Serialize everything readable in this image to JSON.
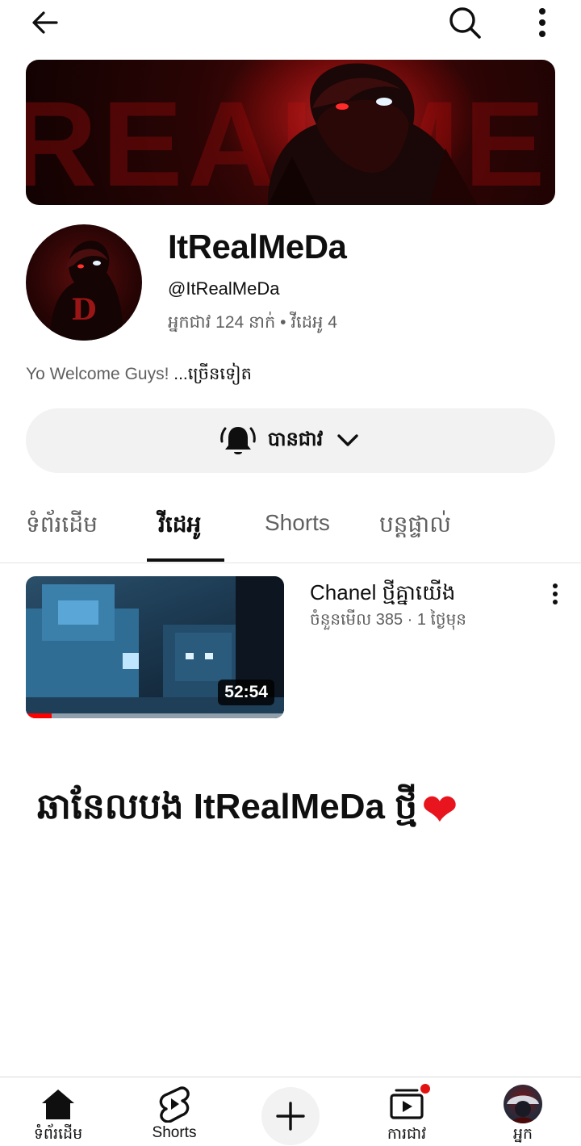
{
  "topbar": {
    "back_icon": "arrow-left-icon",
    "search_icon": "search-icon",
    "more_icon": "more-vertical-icon"
  },
  "banner": {
    "text": "REALME"
  },
  "channel": {
    "name": "ItRealMeDa",
    "handle": "@ItRealMeDa",
    "stats": "អ្នកជាវ 124 នាក់ • វីដេអូ 4",
    "description": "Yo Welcome Guys! ",
    "description_more": "...ច្រើនទៀត"
  },
  "subscribe": {
    "label": "បានជាវ",
    "bell_icon": "bell-icon",
    "chevron_icon": "chevron-down-icon"
  },
  "tabs": [
    {
      "label": "ទំព័រដើម",
      "active": false
    },
    {
      "label": "វីដេអូ",
      "active": true
    },
    {
      "label": "Shorts",
      "active": false
    },
    {
      "label": "បន្តផ្ទាល់",
      "active": false
    }
  ],
  "videos": [
    {
      "title": "Chanel ថ្មីគ្នាយើង",
      "meta": "ចំនួនមើល 385 · 1 ថ្ងៃមុន",
      "duration": "52:54",
      "watched_fraction": 0.1
    }
  ],
  "caption": {
    "text": "ឆានែលបង ItRealMeDa ថ្មី",
    "emoji": "❤"
  },
  "bottom_nav": [
    {
      "label": "ទំព័រដើម",
      "icon": "home-icon"
    },
    {
      "label": "Shorts",
      "icon": "shorts-icon"
    },
    {
      "label": "",
      "icon": "plus-icon"
    },
    {
      "label": "ការជាវ",
      "icon": "subscriptions-icon"
    },
    {
      "label": "អ្នក",
      "icon": "avatar"
    }
  ],
  "colors": {
    "accent_red": "#ff0000",
    "text_primary": "#0f0f0f",
    "text_secondary": "#606060",
    "chip_bg": "#f2f2f2"
  }
}
